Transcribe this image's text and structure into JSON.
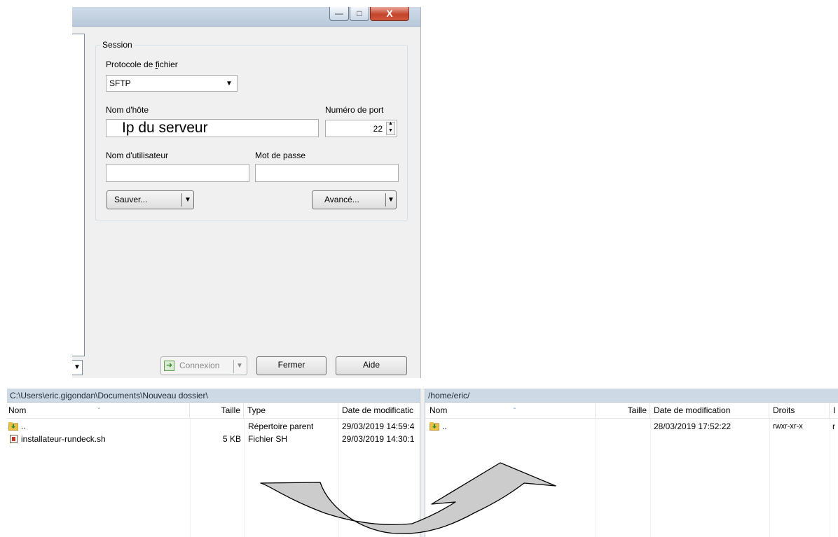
{
  "dialog": {
    "group_title": "Session",
    "protocol_label_prefix": "Protocole de ",
    "protocol_label_accel": "f",
    "protocol_label_suffix": "ichier",
    "protocol_value": "SFTP",
    "host_label": "Nom d'hôte",
    "host_value": "Ip du serveur",
    "port_label": "Numéro de port",
    "port_value": "22",
    "user_label": "Nom d'utilisateur",
    "user_value": "",
    "password_label": "Mot de passe",
    "password_value": "",
    "save_label": "Sauver...",
    "advanced_label": "Avancé...",
    "connect_label": "Connexion",
    "close_label": "Fermer",
    "help_label": "Aide",
    "close_glyph": "X"
  },
  "local_panel": {
    "path": "C:\\Users\\eric.gigondan\\Documents\\Nouveau dossier\\",
    "columns": {
      "name": "Nom",
      "size": "Taille",
      "type": "Type",
      "date": "Date de modificatic"
    },
    "rows": [
      {
        "name": "..",
        "size": "",
        "type": "Répertoire parent",
        "date": "29/03/2019 14:59:4"
      },
      {
        "name": "installateur-rundeck.sh",
        "size": "5 KB",
        "type": "Fichier SH",
        "date": "29/03/2019 14:30:1"
      }
    ]
  },
  "remote_panel": {
    "path": "/home/eric/",
    "columns": {
      "name": "Nom",
      "size": "Taille",
      "date": "Date de modification",
      "rights": "Droits",
      "owner": "I"
    },
    "rows": [
      {
        "name": "..",
        "size": "",
        "date": "28/03/2019 17:52:22",
        "rights": "rwxr-xr-x",
        "owner": "r"
      }
    ]
  },
  "colors": {
    "arrow_fill": "#cccccc",
    "arrow_stroke": "#000000",
    "pathbar_bg": "#cdd9e5"
  }
}
